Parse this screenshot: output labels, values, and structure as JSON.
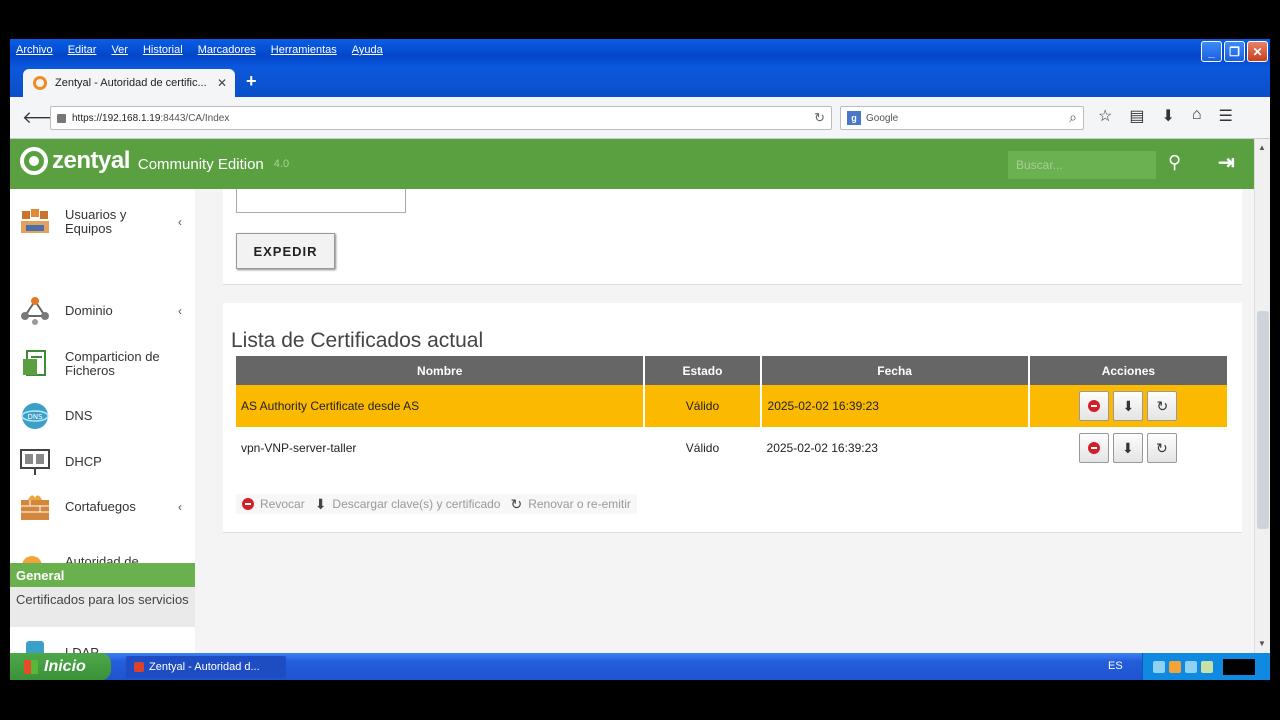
{
  "browser": {
    "menu": [
      "Archivo",
      "Editar",
      "Ver",
      "Historial",
      "Marcadores",
      "Herramientas",
      "Ayuda"
    ],
    "tab_title": "Zentyal - Autoridad de certific...",
    "url_host": "https://192.168.1.19",
    "url_path": ":8443/CA/Index",
    "search_placeholder": "Google",
    "window_buttons": [
      "_",
      "❐",
      "✕"
    ]
  },
  "header": {
    "brand": "zentyal",
    "edition": "Community Edition",
    "version": "4.0",
    "search_placeholder": "Buscar..."
  },
  "sidebar": {
    "items": [
      {
        "label": "Usuarios y Equipos",
        "icon": "users-icon",
        "chevron": "‹"
      },
      {
        "label": "Dominio",
        "icon": "domain-icon",
        "chevron": "‹"
      },
      {
        "label": "Comparticion de Ficheros",
        "icon": "file-sharing-icon",
        "chevron": ""
      },
      {
        "label": "DNS",
        "icon": "dns-icon",
        "chevron": ""
      },
      {
        "label": "DHCP",
        "icon": "dhcp-icon",
        "chevron": ""
      },
      {
        "label": "Cortafuegos",
        "icon": "firewall-icon",
        "chevron": "‹"
      },
      {
        "label": "Autoridad de certificación",
        "icon": "certificate-authority-icon",
        "chevron": "⌄"
      }
    ],
    "sub_active": "General",
    "sub_item": "Certificados para los servicios",
    "cut_item": "LDAP"
  },
  "form": {
    "expedir_label": "EXPEDIR"
  },
  "certs": {
    "title": "Lista de Certificados actual",
    "columns": [
      "Nombre",
      "Estado",
      "Fecha",
      "Acciones"
    ],
    "rows": [
      {
        "name": "AS Authority Certificate desde AS",
        "state": "Válido",
        "date": "2025-02-02 16:39:23",
        "highlight": true
      },
      {
        "name": "vpn-VNP-server-taller",
        "state": "Válido",
        "date": "2025-02-02 16:39:23",
        "highlight": false
      }
    ],
    "legend": {
      "revoke": "Revocar",
      "download": "Descargar clave(s) y certificado",
      "renew": "Renovar o re-emitir"
    }
  },
  "taskbar": {
    "start": "Inicio",
    "task": "Zentyal - Autoridad d...",
    "lang": "ES"
  },
  "colors": {
    "zentyal_green": "#5aa041",
    "highlight_row": "#fbba00",
    "revoke_red": "#d0202a"
  }
}
